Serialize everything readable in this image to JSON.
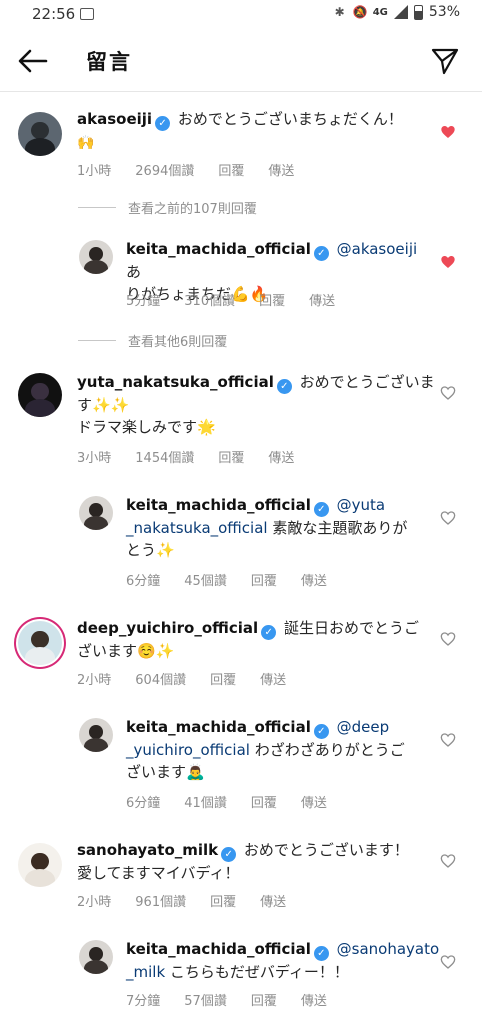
{
  "status": {
    "time": "22:56",
    "network": "4G",
    "battery": "53%"
  },
  "header": {
    "title": "留言"
  },
  "comments": [
    {
      "user": "akasoeiji",
      "text": "おめでとうございまちょだくん！",
      "text2": "🙌",
      "time": "1小時",
      "likes": "2694個讚",
      "reply": "回覆",
      "send": "傳送",
      "liked": true
    },
    {
      "view_more": "查看之前的107則回覆"
    },
    {
      "user": "keita_machida_official",
      "mention": "@akasoeiji",
      "text": " あ",
      "text2": "りがちょまちだ💪🔥",
      "time": "5分鐘",
      "likes": "310個讚",
      "reply": "回覆",
      "send": "傳送",
      "liked": true
    },
    {
      "view_more": "查看其他6則回覆"
    },
    {
      "user": "yuta_nakatsuka_official",
      "text": "おめでとうございま",
      "text2": "す✨✨",
      "text3": "ドラマ楽しみです🌟",
      "time": "3小時",
      "likes": "1454個讚",
      "reply": "回覆",
      "send": "傳送",
      "liked": false
    },
    {
      "user": "keita_machida_official",
      "mention": "@yuta",
      "mention2": "_nakatsuka_official",
      "text2": " 素敵な主題歌ありが",
      "text3": "とう✨",
      "time": "6分鐘",
      "likes": "45個讚",
      "reply": "回覆",
      "send": "傳送",
      "liked": false
    },
    {
      "user": "deep_yuichiro_official",
      "text": "誕生日おめでとうご",
      "text2": "ざいます☺️✨",
      "time": "2小時",
      "likes": "604個讚",
      "reply": "回覆",
      "send": "傳送",
      "liked": false
    },
    {
      "user": "keita_machida_official",
      "mention": "@deep",
      "mention2": "_yuichiro_official",
      "text2": " わざわざありがとうご",
      "text3": "ざいます🙇‍♂️",
      "time": "6分鐘",
      "likes": "41個讚",
      "reply": "回覆",
      "send": "傳送",
      "liked": false
    },
    {
      "user": "sanohayato_milk",
      "text": "おめでとうございます！",
      "text2": "愛してますマイバディ！",
      "time": "2小時",
      "likes": "961個讚",
      "reply": "回覆",
      "send": "傳送",
      "liked": false
    },
    {
      "user": "keita_machida_official",
      "mention": "@sanohayato",
      "mention2": "_milk",
      "text2": " こちらもだぜバディー！！",
      "time": "7分鐘",
      "likes": "57個讚",
      "reply": "回覆",
      "send": "傳送",
      "liked": false
    }
  ],
  "colors": {
    "liked_heart": "#ed4956",
    "verified": "#3897f0",
    "mention": "#0a3b75",
    "story_ring": "#d62976"
  }
}
